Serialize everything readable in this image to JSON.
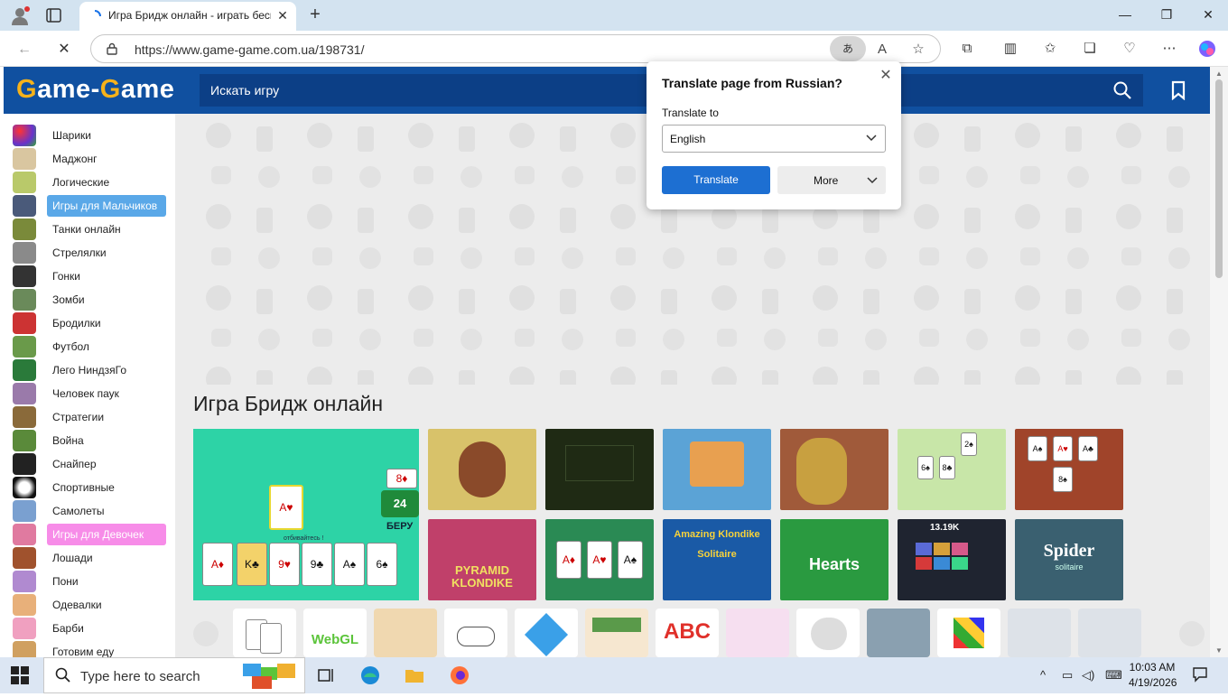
{
  "browser": {
    "tab_title": "Игра Бридж онлайн - играть бесплатно",
    "url": "https://www.game-game.com.ua/198731/",
    "translate_indicator": "あ"
  },
  "site": {
    "logo_part1": "G",
    "logo_part2": "ame-",
    "logo_part3": "G",
    "logo_part4": "ame",
    "search_placeholder": "Искать игру",
    "page_heading": "Игра Бридж онлайн"
  },
  "sidebar": {
    "items": [
      {
        "label": "Шарики"
      },
      {
        "label": "Маджонг"
      },
      {
        "label": "Логические"
      },
      {
        "label": "Игры для Мальчиков"
      },
      {
        "label": "Танки онлайн"
      },
      {
        "label": "Стрелялки"
      },
      {
        "label": "Гонки"
      },
      {
        "label": "Зомби"
      },
      {
        "label": "Бродилки"
      },
      {
        "label": "Футбол"
      },
      {
        "label": "Лего НиндзяГо"
      },
      {
        "label": "Человек паук"
      },
      {
        "label": "Стратегии"
      },
      {
        "label": "Война"
      },
      {
        "label": "Снайпер"
      },
      {
        "label": "Спортивные"
      },
      {
        "label": "Самолеты"
      },
      {
        "label": "Игры для Девочек"
      },
      {
        "label": "Лошади"
      },
      {
        "label": "Пони"
      },
      {
        "label": "Одевалки"
      },
      {
        "label": "Барби"
      },
      {
        "label": "Готовим еду"
      }
    ]
  },
  "game_tiles": {
    "big_tile": {
      "caption": "отбивайтесь !",
      "badge": "24",
      "take": "БЕРУ"
    },
    "pyramid": "PYRAMID KLONDIKE",
    "amazing": "Amazing Klondike Solitaire",
    "hearts": "Hearts",
    "score": "13.19K",
    "spider": "Spider",
    "spider_sub": "solitaire"
  },
  "strip": {
    "webgl": "WebGL",
    "abc": "ABC"
  },
  "translate_popup": {
    "title": "Translate page from Russian?",
    "translate_to_label": "Translate to",
    "language": "English",
    "translate_button": "Translate",
    "more_button": "More"
  },
  "taskbar": {
    "search_text": "Type here to search",
    "time": "10:03 AM",
    "date": "4/19/2026"
  },
  "colors": {
    "site_blue": "#1050a0",
    "logo_orange": "#f6b21b",
    "boys_blue": "#5aa8e8",
    "girls_pink": "#f78ce8",
    "translate_blue": "#1d6fd2"
  }
}
